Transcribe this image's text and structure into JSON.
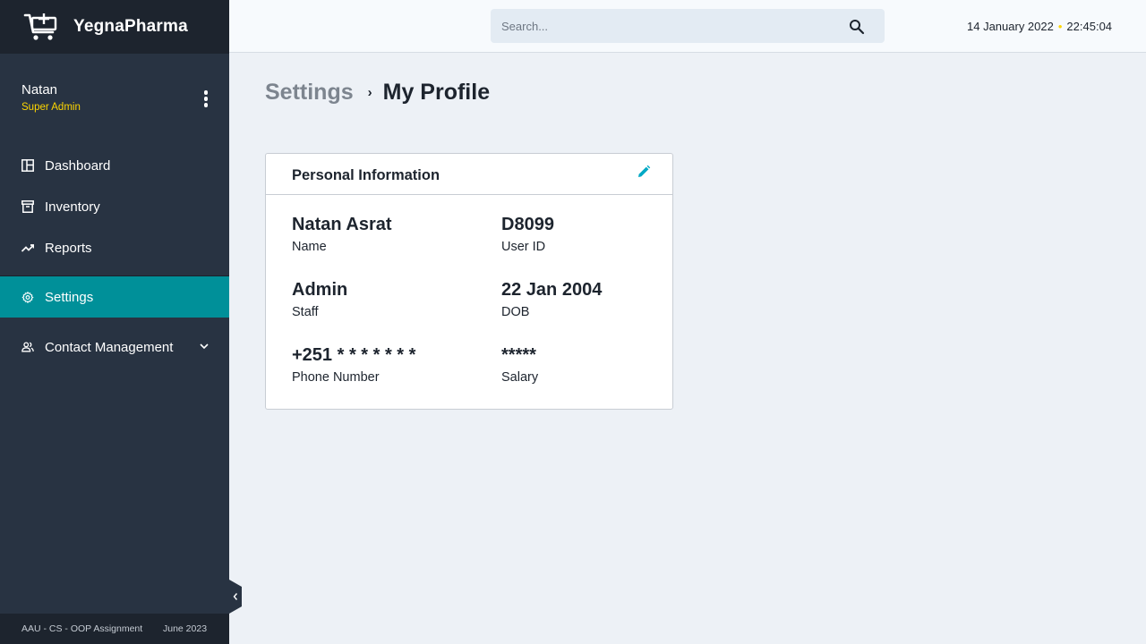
{
  "app": {
    "name": "YegnaPharma"
  },
  "user": {
    "name": "Natan",
    "role": "Super Admin"
  },
  "nav": {
    "dashboard": "Dashboard",
    "inventory": "Inventory",
    "reports": "Reports",
    "settings": "Settings",
    "contact": "Contact Management"
  },
  "footer": {
    "left": "AAU - CS - OOP Assignment",
    "right": "June 2023"
  },
  "search": {
    "placeholder": "Search..."
  },
  "datetime": {
    "date": "14 January 2022",
    "time": "22:45:04"
  },
  "breadcrumb": {
    "parent": "Settings",
    "current": "My Profile"
  },
  "card": {
    "title": "Personal Information",
    "name_value": "Natan Asrat",
    "name_label": "Name",
    "userid_value": "D8099",
    "userid_label": "User ID",
    "staff_value": "Admin",
    "staff_label": "Staff",
    "dob_value": "22 Jan 2004",
    "dob_label": "DOB",
    "phone_value": "+251 * * * * * * *",
    "phone_label": "Phone Number",
    "salary_value": "*****",
    "salary_label": "Salary"
  },
  "colors": {
    "sidebar": "#283342",
    "sidebar_dark": "#1d242e",
    "active": "#009099",
    "accent_yellow": "#fed600",
    "edit_icon": "#03a9c5"
  },
  "icons": [
    "cart-plus-icon",
    "kebab-menu-icon",
    "dashboard-icon",
    "inventory-icon",
    "reports-icon",
    "gear-icon",
    "users-icon",
    "chevron-down-icon",
    "search-icon",
    "pencil-icon",
    "chevron-left-icon"
  ]
}
